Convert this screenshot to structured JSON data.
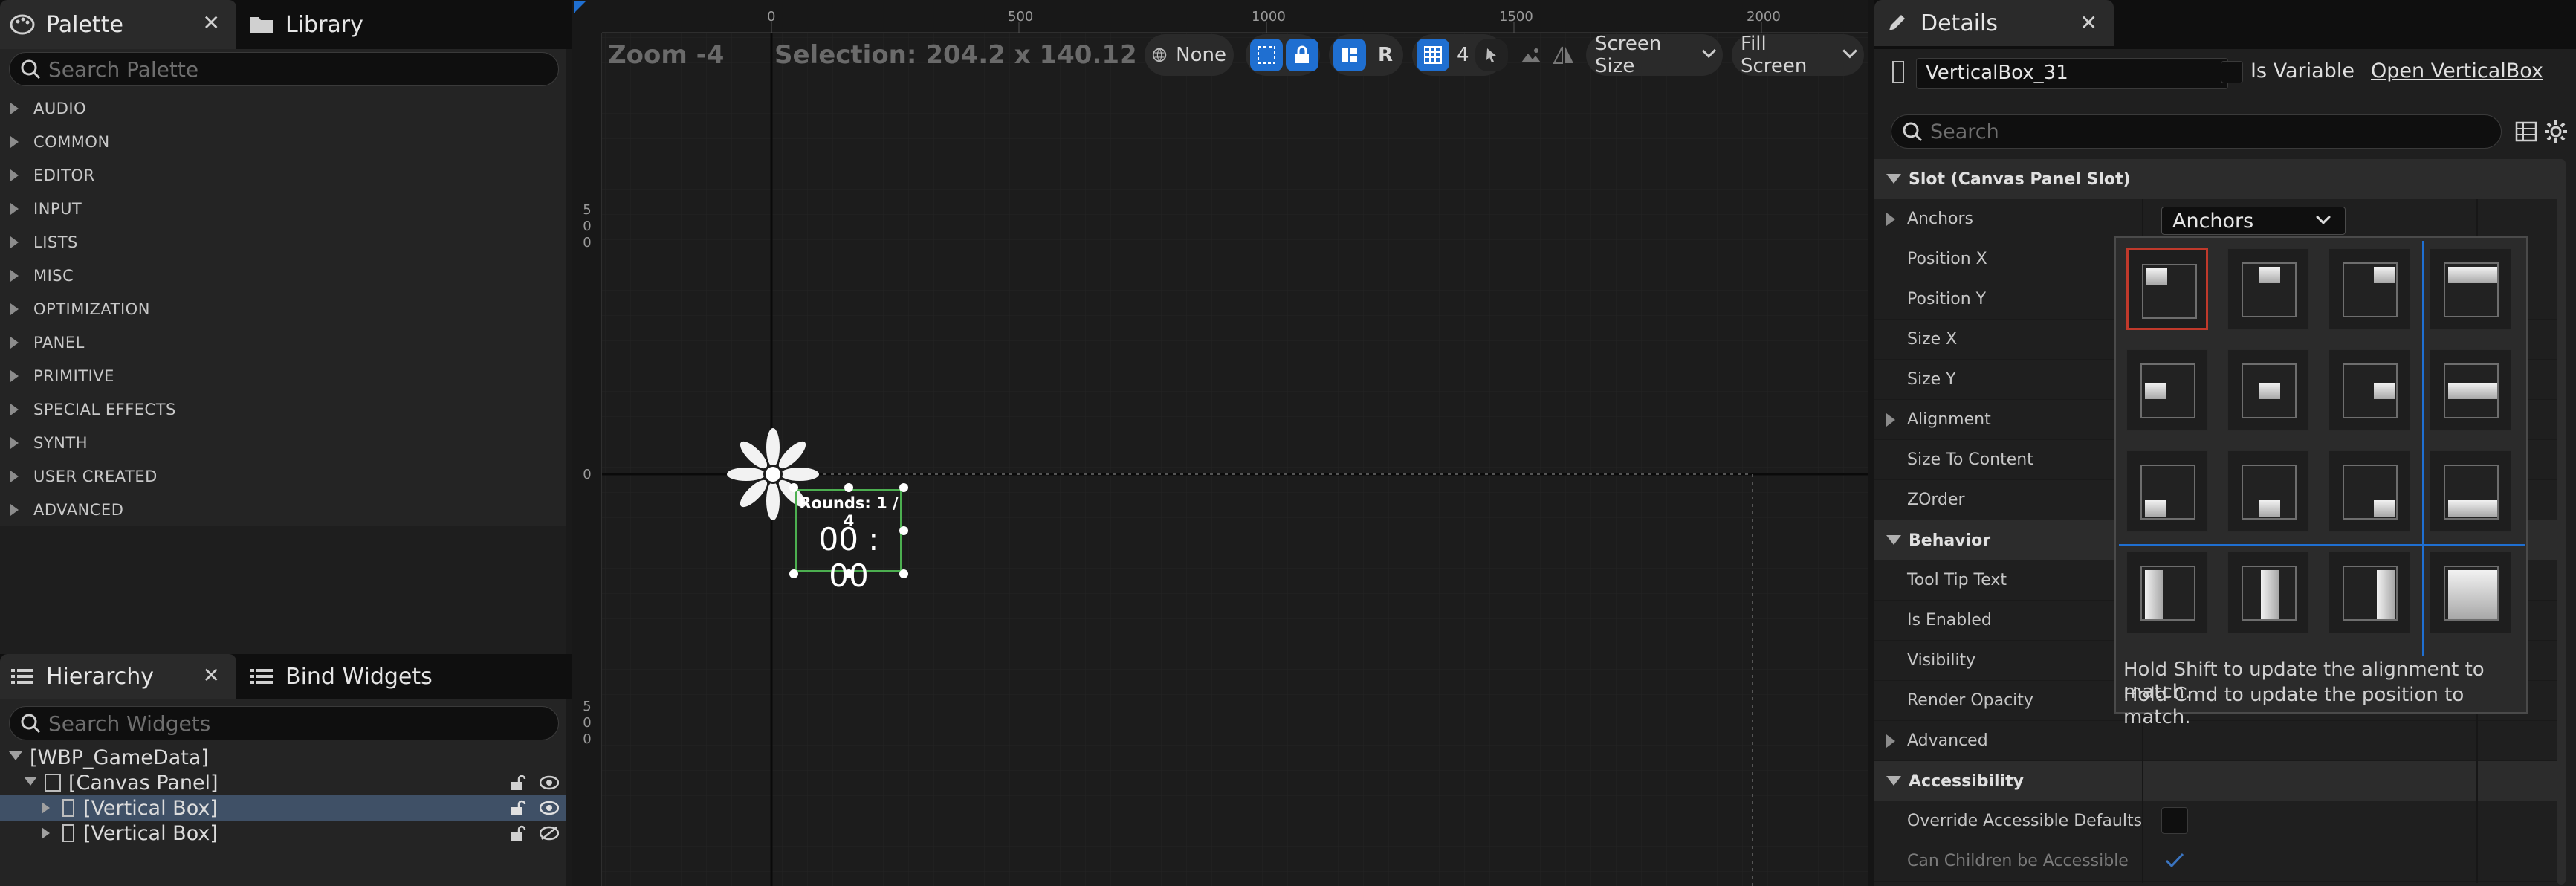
{
  "palette": {
    "tab_label": "Palette",
    "close": "✕",
    "library_tab": "Library",
    "search_placeholder": "Search Palette",
    "categories": [
      "AUDIO",
      "COMMON",
      "EDITOR",
      "INPUT",
      "LISTS",
      "MISC",
      "OPTIMIZATION",
      "PANEL",
      "PRIMITIVE",
      "SPECIAL EFFECTS",
      "SYNTH",
      "USER CREATED",
      "ADVANCED"
    ]
  },
  "hierarchy": {
    "tab_label": "Hierarchy",
    "close": "✕",
    "bind_tab": "Bind Widgets",
    "search_placeholder": "Search Widgets",
    "items": [
      {
        "label": "[WBP_GameData]"
      },
      {
        "label": "[Canvas Panel]"
      },
      {
        "label": "[Vertical Box]"
      },
      {
        "label": "[Vertical Box]"
      }
    ]
  },
  "canvas": {
    "zoom": "Zoom -4",
    "selection": "Selection: 204.2 x 140.12",
    "ruler_top": [
      "0",
      "500",
      "1000",
      "1500",
      "2000"
    ],
    "ruler_left": [
      [
        "5",
        "0",
        "0"
      ],
      [
        "0"
      ],
      [
        "5",
        "0",
        "0"
      ]
    ],
    "widget_rounds": "Rounds: 1 / 4",
    "widget_time": "00 : 00",
    "toolbar": {
      "none_label": "None",
      "r_label": "R",
      "grid_value": "4",
      "screen_size": "Screen Size",
      "fill_screen": "Fill Screen"
    }
  },
  "details": {
    "tab_label": "Details",
    "close": "✕",
    "widget_name": "VerticalBox_31",
    "is_variable": "Is Variable",
    "open_link": "Open VerticalBox",
    "search_placeholder": "Search",
    "sections": {
      "slot": "Slot (Canvas Panel Slot)",
      "behavior": "Behavior",
      "accessibility": "Accessibility"
    },
    "rows": {
      "anchors": "Anchors",
      "position_x": "Position X",
      "position_y": "Position Y",
      "size_x": "Size X",
      "size_y": "Size Y",
      "alignment": "Alignment",
      "size_to_content": "Size To Content",
      "zorder": "ZOrder",
      "tooltip": "Tool Tip Text",
      "is_enabled": "Is Enabled",
      "visibility": "Visibility",
      "render_opacity": "Render Opacity",
      "advanced": "Advanced",
      "override_accessible": "Override Accessible Defaults",
      "children_accessible": "Can Children be Accessible"
    },
    "anchors_dropdown": "Anchors",
    "anchor_hint_1": "Hold Shift to update the alignment to match.",
    "anchor_hint_2": "Hold Cmd to update the position to match."
  },
  "colors": {
    "accent_blue": "#1f6fd1",
    "selection_row": "#3f5066",
    "selected_anchor_border": "#c0392b",
    "widget_outline": "#4caf50"
  }
}
